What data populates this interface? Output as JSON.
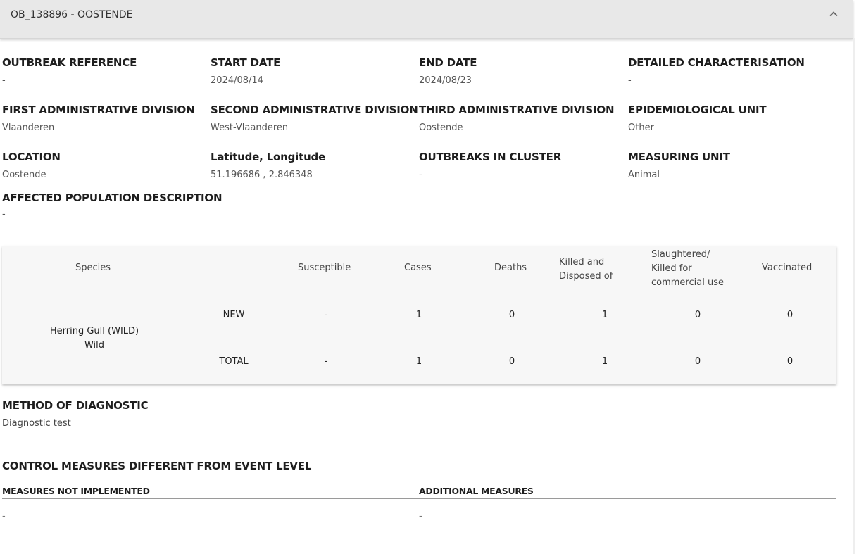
{
  "header": {
    "title": "OB_138896 - OOSTENDE",
    "toggle_icon": "chevron-up-icon"
  },
  "fields": [
    {
      "label": "OUTBREAK REFERENCE",
      "value": "-"
    },
    {
      "label": "START DATE",
      "value": "2024/08/14"
    },
    {
      "label": "END DATE",
      "value": "2024/08/23"
    },
    {
      "label": "DETAILED CHARACTERISATION",
      "value": "-"
    },
    {
      "label": "FIRST ADMINISTRATIVE DIVISION",
      "value": "Vlaanderen"
    },
    {
      "label": "SECOND ADMINISTRATIVE DIVISION",
      "value": "West-Vlaanderen"
    },
    {
      "label": "THIRD ADMINISTRATIVE DIVISION",
      "value": "Oostende"
    },
    {
      "label": "EPIDEMIOLOGICAL UNIT",
      "value": "Other"
    },
    {
      "label": "LOCATION",
      "value": "Oostende"
    },
    {
      "label": "Latitude, Longitude",
      "value": "51.196686 , 2.846348"
    },
    {
      "label": "OUTBREAKS IN CLUSTER",
      "value": "-"
    },
    {
      "label": "MEASURING UNIT",
      "value": "Animal"
    },
    {
      "label": "AFFECTED POPULATION DESCRIPTION",
      "value": "-"
    }
  ],
  "table": {
    "headers": {
      "species": "Species",
      "susceptible": "Susceptible",
      "cases": "Cases",
      "deaths": "Deaths",
      "killed": [
        "Killed and",
        "Disposed of"
      ],
      "slaughtered": [
        "Slaughtered/",
        "Killed for",
        "commercial use"
      ],
      "vaccinated": "Vaccinated"
    },
    "species_name": "Herring Gull (WILD)",
    "species_type": "Wild",
    "rows": [
      {
        "type": "NEW",
        "susceptible": "-",
        "cases": "1",
        "deaths": "0",
        "killed": "1",
        "slaughtered": "0",
        "vaccinated": "0"
      },
      {
        "type": "TOTAL",
        "susceptible": "-",
        "cases": "1",
        "deaths": "0",
        "killed": "1",
        "slaughtered": "0",
        "vaccinated": "0"
      }
    ]
  },
  "diagnostic": {
    "label": "METHOD OF DIAGNOSTIC",
    "value": "Diagnostic test"
  },
  "control_measures": {
    "title": "CONTROL MEASURES DIFFERENT FROM EVENT LEVEL",
    "not_implemented_label": "MEASURES NOT IMPLEMENTED",
    "not_implemented_value": "-",
    "additional_label": "ADDITIONAL MEASURES",
    "additional_value": "-"
  }
}
